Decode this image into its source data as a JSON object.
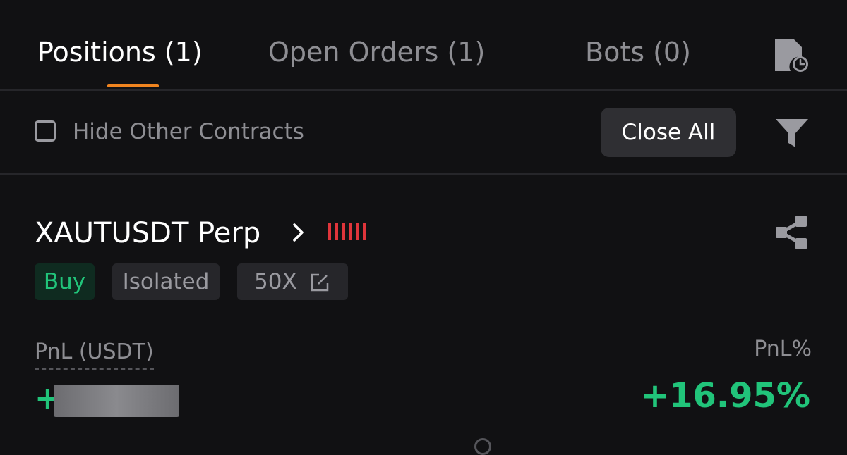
{
  "tabs": [
    {
      "label": "Positions (1)",
      "active": true
    },
    {
      "label": "Open Orders (1)",
      "active": false
    },
    {
      "label": "Bots (0)",
      "active": false
    }
  ],
  "icons": {
    "history": "order-history-icon",
    "filter": "filter-icon",
    "share": "share-icon",
    "chevron": "chevron-right-icon",
    "edit": "edit-icon"
  },
  "filter_bar": {
    "hide_other_contracts_label": "Hide Other Contracts",
    "hide_other_contracts_checked": false,
    "close_all_label": "Close All"
  },
  "position": {
    "symbol": "XAUTUSDT Perp",
    "badges": {
      "side": "Buy",
      "margin_mode": "Isolated",
      "leverage": "50X"
    },
    "pnl_label": "PnL (USDT)",
    "pnl_value_sign": "+",
    "pnl_pct_label": "PnL%",
    "pnl_pct_value": "+16.95%"
  },
  "colors": {
    "accent": "#f0841f",
    "positive": "#21c47a",
    "risk": "#e0353b",
    "background": "#111113"
  }
}
